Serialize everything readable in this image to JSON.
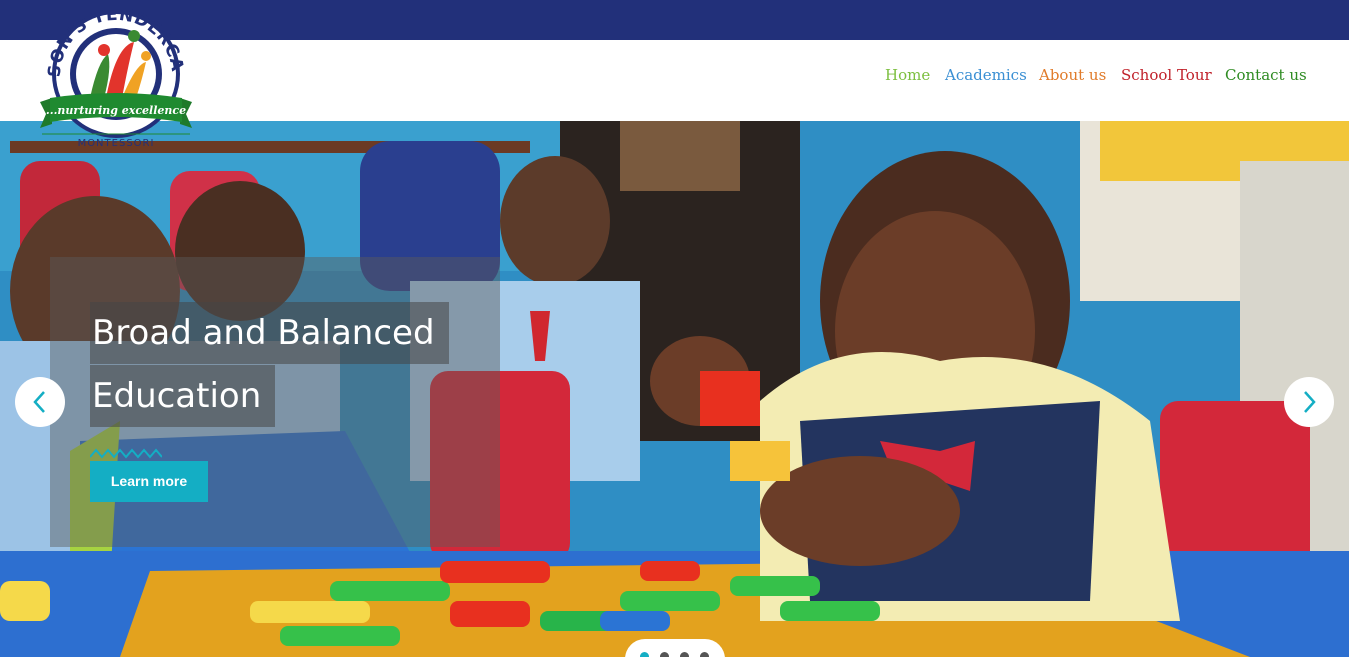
{
  "logo": {
    "school_name": "JASON'S TENDERCARE",
    "tagline": "...nurturing excellence",
    "subtitle": "MONTESSORI"
  },
  "nav": {
    "items": [
      {
        "label": "Home",
        "color": "#7cbf3f"
      },
      {
        "label": "Academics",
        "color": "#3a8fd3"
      },
      {
        "label": "About us",
        "color": "#e07b2a"
      },
      {
        "label": "School Tour",
        "color": "#c0212a"
      },
      {
        "label": "Contact us",
        "color": "#2e8b22"
      }
    ]
  },
  "hero": {
    "title_line1": "Broad and Balanced",
    "title_line2": "Education",
    "button_label": "Learn more",
    "prev_icon": "chevron-left-icon",
    "next_icon": "chevron-right-icon",
    "slide_count": 4,
    "active_slide": 1
  },
  "colors": {
    "topbar": "#22307a",
    "accent": "#14aec4"
  }
}
